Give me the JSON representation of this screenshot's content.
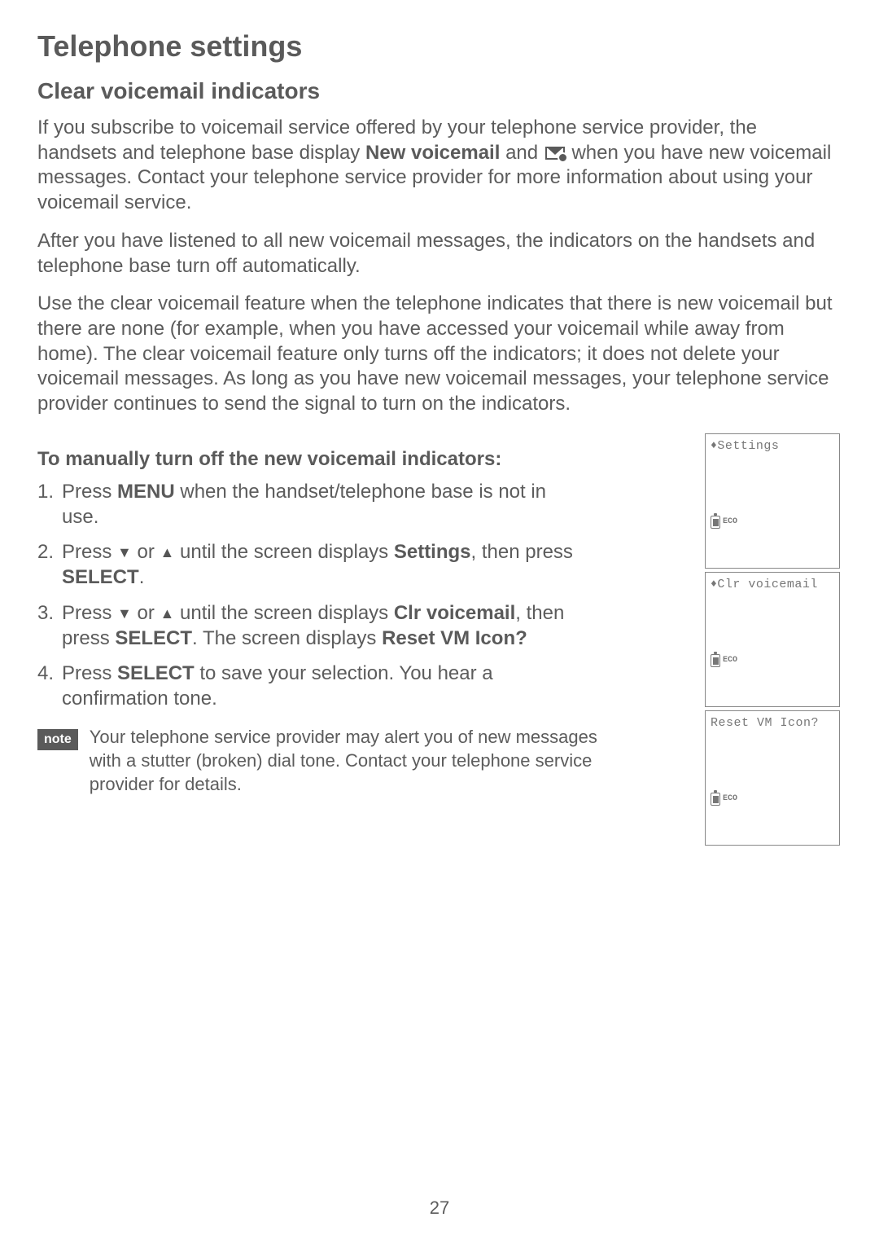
{
  "page_number": "27",
  "title": "Telephone settings",
  "section_heading": "Clear voicemail indicators",
  "para1_a": "If you subscribe to voicemail service offered by your telephone service provider, the handsets and telephone base display ",
  "para1_bold": "New voicemail",
  "para1_b": " and ",
  "para1_c": " when you have new voicemail messages. Contact your telephone service provider for more information about using your voicemail service.",
  "para2": "After you have listened to all new voicemail messages, the indicators on the handsets and telephone base turn off automatically.",
  "para3": "Use the clear voicemail feature when the telephone indicates that there is new voicemail but there are none (for example, when you have accessed your voicemail while away from home). The clear voicemail feature only turns off the indicators; it does not delete your voicemail messages. As long as you have new voicemail messages, your telephone service provider continues to send the signal to turn on the indicators.",
  "steps_heading": "To manually turn off the new voicemail indicators:",
  "step1_a": "Press ",
  "step1_menu": "MENU",
  "step1_b": " when the handset/telephone base is not in use.",
  "step2_a": "Press ",
  "step2_b": " or ",
  "step2_c": " until the screen displays ",
  "step2_settings": "Settings",
  "step2_d": ", then press ",
  "step2_select": "SELECT",
  "step2_e": ".",
  "step3_a": "Press ",
  "step3_b": " or ",
  "step3_c": " until the screen displays ",
  "step3_clr": "Clr voicemail",
  "step3_d": ", then press ",
  "step3_select": "SELECT",
  "step3_e": ". The screen displays ",
  "step3_reset": "Reset VM Icon?",
  "step4_a": "Press ",
  "step4_select": "SELECT",
  "step4_b": " to save your selection. You hear a confirmation tone.",
  "note_label": "note",
  "note_text": "Your telephone service provider may alert you of new messages with a stutter (broken) dial tone. Contact your telephone service provider for details.",
  "screens": {
    "s1_top": "Settings",
    "s1_eco": "ECO",
    "s2_top": "Clr voicemail",
    "s2_eco": "ECO",
    "s3_top": "Reset VM Icon?",
    "s3_eco": "ECO"
  },
  "glyphs": {
    "down": "▼",
    "up": "▲",
    "updown": "♦"
  }
}
